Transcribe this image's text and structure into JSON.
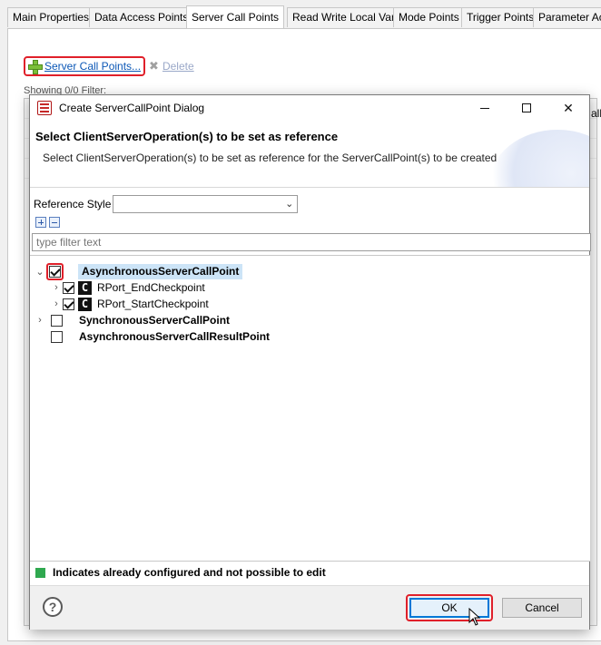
{
  "tabs": [
    {
      "label": "Main Properties"
    },
    {
      "label": "Data Access Points"
    },
    {
      "label": "Server Call Points",
      "active": true
    },
    {
      "label": "Read Write Local Var"
    },
    {
      "label": "Mode Points"
    },
    {
      "label": "Trigger Points"
    },
    {
      "label": "Parameter Ac"
    }
  ],
  "editor": {
    "add_link": "Server Call Points...",
    "delete_link": "Delete",
    "partial_col_text": "all",
    "subtoolbar_text": "Showing 0/0 Filter:"
  },
  "dialog": {
    "title": "Create ServerCallPoint Dialog",
    "header_title": "Select ClientServerOperation(s) to be set as reference",
    "header_message": "Select ClientServerOperation(s) to be set as reference for the ServerCallPoint(s) to be created",
    "reference_style_label": "Reference Style",
    "reference_style_value": "",
    "filter_placeholder": "type filter text",
    "tree": [
      {
        "label": "AsynchronousServerCallPoint",
        "checked": true,
        "expanded": true,
        "selected": true
      },
      {
        "label": "RPort_EndCheckpoint",
        "checked": true,
        "icon": "C"
      },
      {
        "label": "RPort_StartCheckpoint",
        "checked": true,
        "icon": "C"
      },
      {
        "label": "SynchronousServerCallPoint",
        "checked": false
      },
      {
        "label": "AsynchronousServerCallResultPoint",
        "checked": false
      }
    ],
    "legend_text": "Indicates already configured and not possible to edit",
    "ok_label": "OK",
    "cancel_label": "Cancel",
    "help_glyph": "?"
  },
  "colors": {
    "highlight": "#e0202a",
    "legend_green": "#2fa84f",
    "selection": "#cce4f7",
    "link": "#0b57b6"
  }
}
